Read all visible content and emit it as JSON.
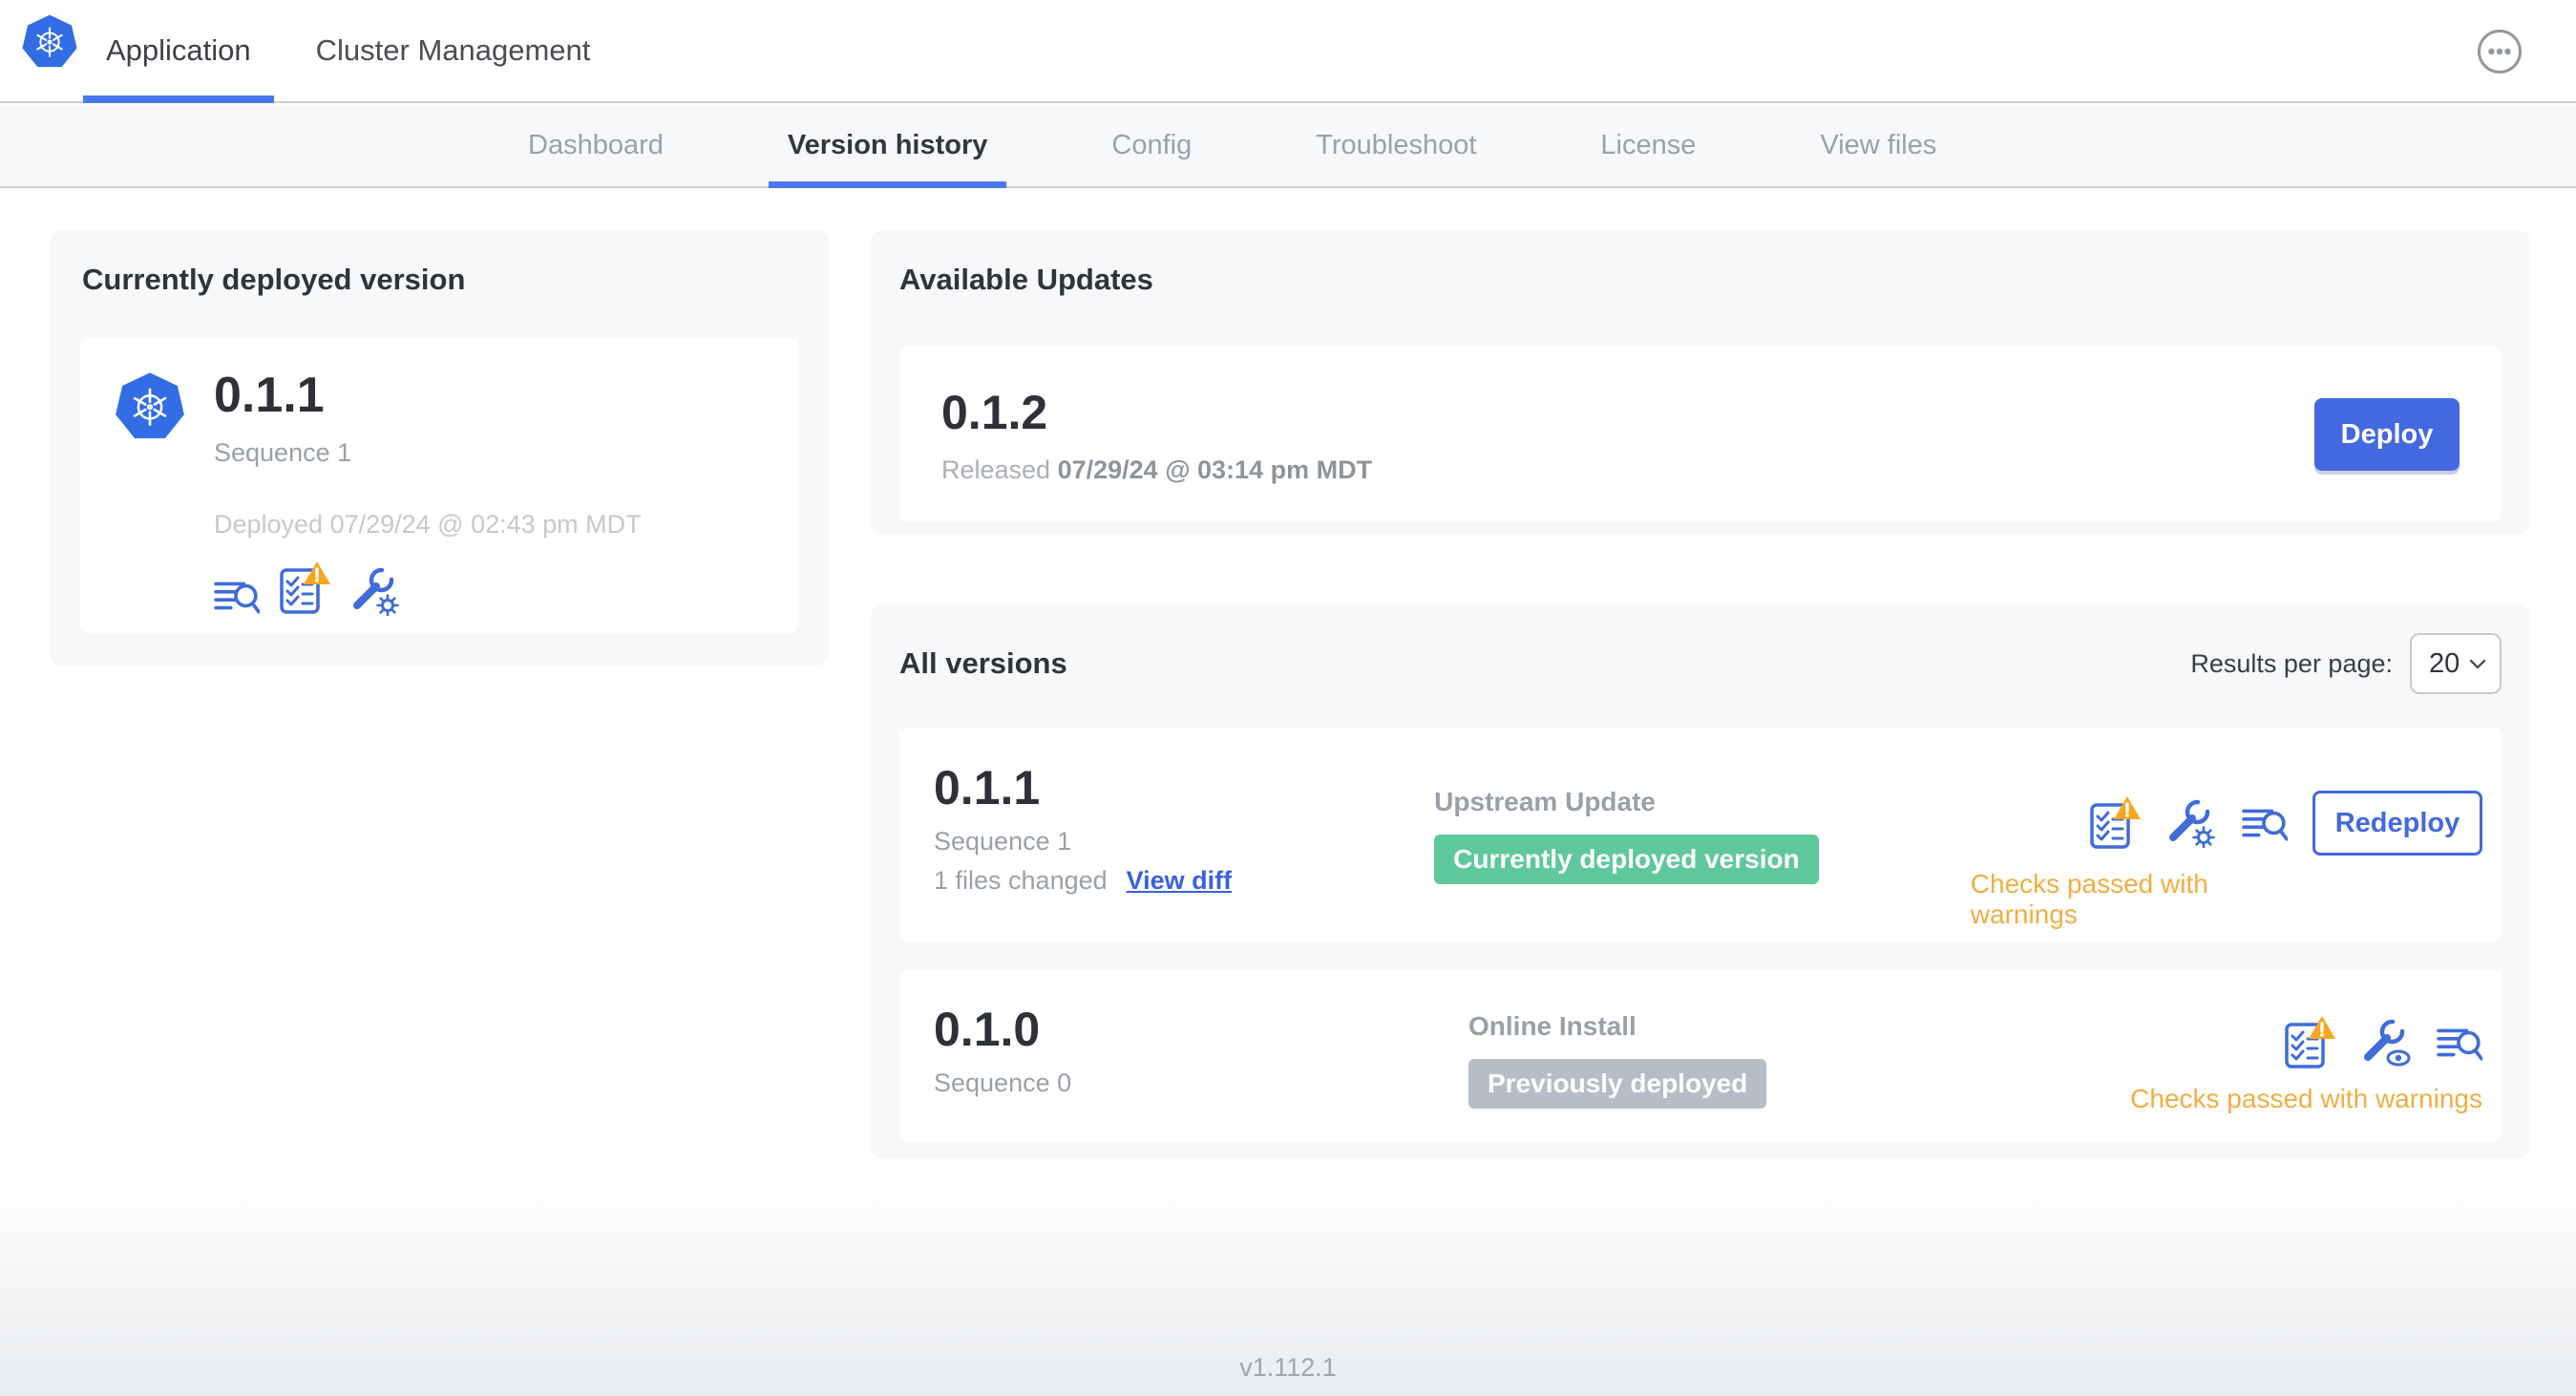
{
  "header": {
    "tabs": [
      {
        "label": "Application",
        "active": true
      },
      {
        "label": "Cluster Management",
        "active": false
      }
    ],
    "more_icon": "ellipsis-circle"
  },
  "subnav": {
    "tabs": [
      "Dashboard",
      "Version history",
      "Config",
      "Troubleshoot",
      "License",
      "View files"
    ],
    "active": "Version history"
  },
  "current_version_card": {
    "title": "Currently deployed version",
    "version": "0.1.1",
    "sequence": "Sequence 1",
    "deployed": "Deployed 07/29/24 @ 02:43 pm MDT",
    "icons": [
      "logs-icon",
      "preflight-checks-warning-icon",
      "config-icon"
    ]
  },
  "available_updates": {
    "title": "Available Updates",
    "version": "0.1.2",
    "released_prefix": "Released",
    "released_date": "07/29/24 @ 03:14 pm MDT",
    "deploy_label": "Deploy"
  },
  "all_versions": {
    "title": "All versions",
    "results_per_page_label": "Results per page:",
    "results_per_page_value": "20",
    "rows": [
      {
        "version": "0.1.1",
        "sequence": "Sequence 1",
        "files_changed": "1 files changed",
        "view_diff_label": "View diff",
        "source": "Upstream Update",
        "badge": "Currently deployed version",
        "badge_color": "#5fc89a",
        "icons": [
          "preflight-checks-warning-icon",
          "config-icon",
          "logs-icon"
        ],
        "action_label": "Redeploy",
        "status": "Checks passed with warnings"
      },
      {
        "version": "0.1.0",
        "sequence": "Sequence 0",
        "source": "Online Install",
        "badge": "Previously deployed",
        "badge_color": "#b5bec7",
        "icons": [
          "preflight-checks-warning-icon",
          "config-view-icon",
          "logs-icon"
        ],
        "status": "Checks passed with warnings"
      }
    ]
  },
  "footer": {
    "version": "v1.112.1"
  },
  "colors": {
    "accent_blue": "#4368e0",
    "underline_blue": "#4a78ee",
    "kubernetes_blue": "#326de6",
    "icon_blue": "#3f6cd8",
    "badge_green": "#5fc89a",
    "badge_gray": "#b5bec7",
    "warning_orange": "#efae41",
    "triangle_orange": "#f6a71f",
    "card_background": "#f7f8fa"
  }
}
